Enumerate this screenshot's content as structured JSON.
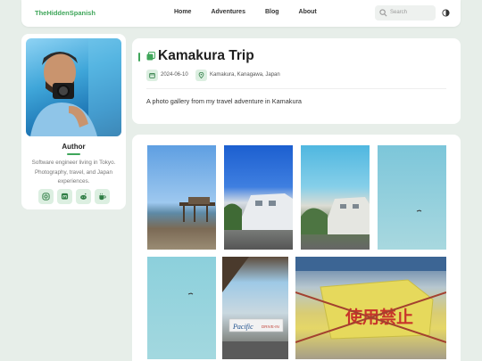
{
  "header": {
    "brand": "TheHiddenSpanish",
    "nav": [
      {
        "label": "Home"
      },
      {
        "label": "Adventures"
      },
      {
        "label": "Blog"
      },
      {
        "label": "About"
      }
    ],
    "search": {
      "placeholder": "Search"
    },
    "icons": {
      "search": "search-icon",
      "theme": "theme-toggle-icon"
    }
  },
  "author": {
    "name": "Author",
    "bio": "Software engineer living in Tokyo. Photography, travel, and Japan experiences.",
    "social": [
      {
        "icon": "instagram-icon"
      },
      {
        "icon": "mastodon-icon"
      },
      {
        "icon": "reddit-icon"
      },
      {
        "icon": "coffee-icon"
      }
    ]
  },
  "post": {
    "title": "Kamakura Trip",
    "date": "2024-06-10",
    "location": "Kamakura, Kanagawa, Japan",
    "description": "A photo gallery from my travel adventure in Kamakura"
  },
  "gallery": {
    "photos": [
      {
        "subject": "beach with pier"
      },
      {
        "subject": "white building blue sky"
      },
      {
        "subject": "white building on hill"
      },
      {
        "subject": "sky with bird"
      },
      {
        "subject": "sky with bird"
      },
      {
        "subject": "Pacific Drive-In sign"
      },
      {
        "subject": "yellow banner on fence"
      }
    ]
  },
  "colors": {
    "accent": "#3fa65a",
    "accent_light": "#dcefe1",
    "page_bg": "#e7eee9",
    "card_bg": "#ffffff"
  }
}
